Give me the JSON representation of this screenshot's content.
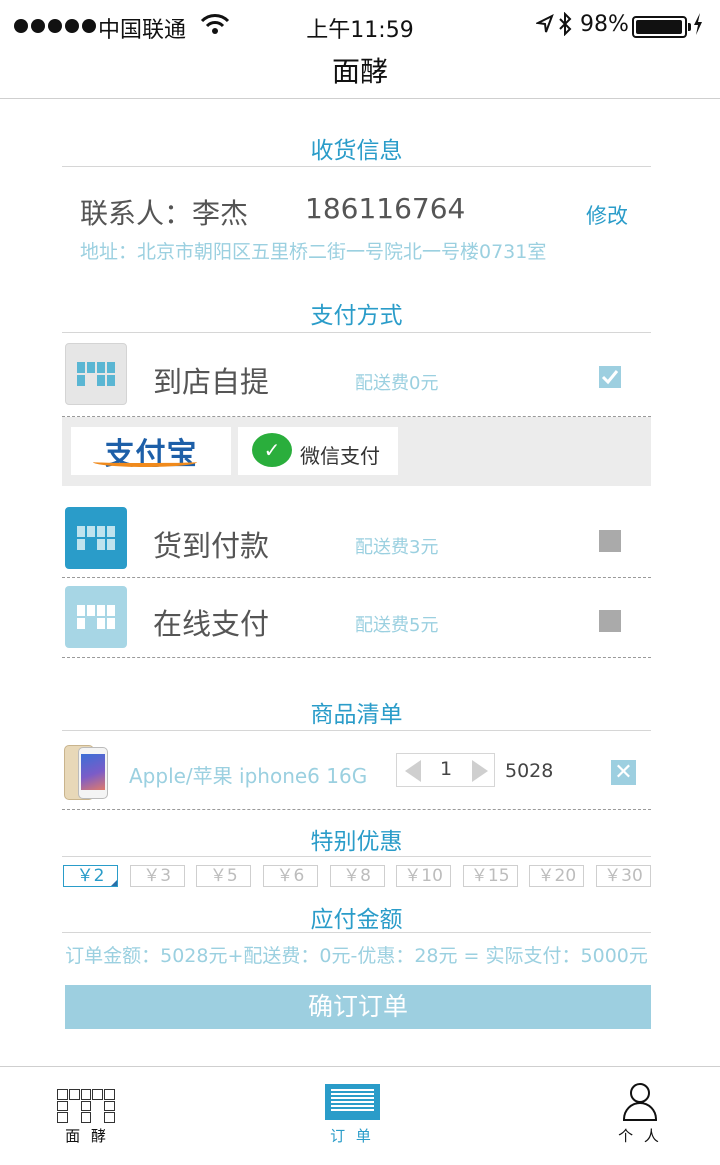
{
  "status_bar": {
    "carrier": "中国联通",
    "time": "上午11:59",
    "battery_percent": "98%",
    "battery_level": 0.98,
    "icons": [
      "signal-dots-icon",
      "wifi-icon",
      "location-arrow-icon",
      "bluetooth-icon",
      "battery-icon",
      "charging-bolt-icon"
    ]
  },
  "nav": {
    "title": "面酵"
  },
  "delivery": {
    "section_title": "收货信息",
    "contact": "联系人：李杰",
    "phone": "186116764",
    "edit_label": "修改",
    "address": "地址：北京市朝阳区五里桥二街一号院北一号楼0731室"
  },
  "payment": {
    "section_title": "支付方式",
    "options": [
      {
        "label": "到店自提",
        "fee": "配送费0元",
        "checked": true,
        "icon_color": "#e6e6e6",
        "glyph_color": "#5ab6d3"
      },
      {
        "label": "货到付款",
        "fee": "配送费3元",
        "checked": false,
        "icon_color": "#2a9cc9",
        "glyph_color": "#bfe3ee"
      },
      {
        "label": "在线支付",
        "fee": "配送费5元",
        "checked": false,
        "icon_color": "#a7d6e5",
        "glyph_color": "#ffffff"
      }
    ],
    "alipay_label": "支付宝",
    "wechat_label": "微信支付"
  },
  "goods": {
    "section_title": "商品清单",
    "item_name": "Apple/苹果 iphone6 16G",
    "quantity": "1",
    "price": "5028"
  },
  "discount": {
    "section_title": "特别优惠",
    "coupons": [
      "￥2",
      "￥3",
      "￥5",
      "￥6",
      "￥8",
      "￥10",
      "￥15",
      "￥20",
      "￥30"
    ],
    "selected_index": 0
  },
  "payable": {
    "section_title": "应付金额",
    "summary": "订单金额：5028元+配送费：0元-优惠：28元 = 实际支付：5000元",
    "confirm_label": "确订订单"
  },
  "tabbar": {
    "tabs": [
      {
        "label": "面 酵",
        "icon": "menu-grid-icon",
        "active": false
      },
      {
        "label": "订 单",
        "icon": "order-list-icon",
        "active": true
      },
      {
        "label": "个 人",
        "icon": "person-icon",
        "active": false
      }
    ]
  },
  "colors": {
    "accent": "#2a9cc9",
    "light_accent": "#9bd0e0",
    "button": "#9dcfe0"
  }
}
